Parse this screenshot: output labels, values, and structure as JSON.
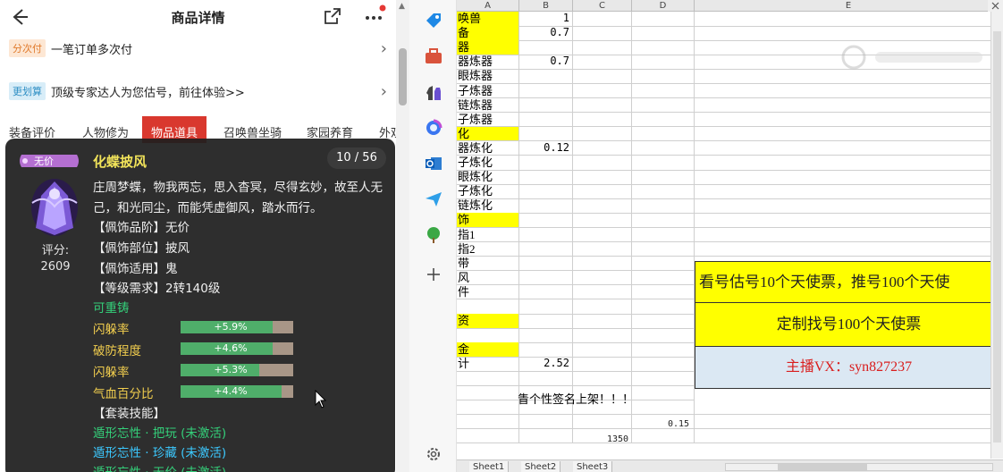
{
  "header": {
    "title": "商品详情"
  },
  "rows": [
    {
      "tag": "分次付",
      "text": "一笔订单多次付"
    },
    {
      "tag": "更划算",
      "text": "顶级专家达人为您估号，前往体验>>"
    }
  ],
  "tabs": [
    "装备评价",
    "人物修为",
    "物品道具",
    "召唤兽坐骑",
    "家园养育",
    "外观"
  ],
  "card": {
    "badge": "无价",
    "name": "化蝶披风",
    "counter": "10 / 56",
    "score_label": "评分:",
    "score": "2609",
    "desc": "庄周梦蝶，物我两忘，思入杳冥，尽得玄妙，故至人无己，和光同尘，而能凭虚御风，踏水而行。",
    "props": [
      "【佩饰品阶】无价",
      "【佩饰部位】披风",
      "【佩饰适用】鬼",
      "【等级需求】2转140级"
    ],
    "reforge": "可重铸",
    "stats": [
      {
        "name": "闪躲率",
        "value": "+5.9%",
        "fill": 0.82
      },
      {
        "name": "破防程度",
        "value": "+4.6%",
        "fill": 0.82
      },
      {
        "name": "闪躲率",
        "value": "+5.3%",
        "fill": 0.7
      },
      {
        "name": "气血百分比",
        "value": "+4.4%",
        "fill": 0.9
      }
    ],
    "set_skill": "【套装技能】",
    "skills": [
      "遁形忘性 · 把玩 (未激活)",
      "遁形忘性 · 珍藏 (未激活)",
      "遁形忘性 · 无价 (未激活)"
    ]
  },
  "spreadsheet": {
    "columns": [
      "A",
      "B",
      "C",
      "D",
      "E"
    ],
    "rows": [
      {
        "a": "唤兽",
        "b": "1",
        "yel": true
      },
      {
        "a": "备",
        "b": "0.7",
        "yel": true
      },
      {
        "a": "器",
        "b": "",
        "yel": true
      },
      {
        "a": "器炼器",
        "b": "0.7",
        "yel": false
      },
      {
        "a": "眼炼器",
        "b": "",
        "yel": false
      },
      {
        "a": "子炼器",
        "b": "",
        "yel": false
      },
      {
        "a": "链炼器",
        "b": "",
        "yel": false
      },
      {
        "a": "子炼器",
        "b": "",
        "yel": false
      },
      {
        "a": "化",
        "b": "",
        "yel": true
      },
      {
        "a": "器炼化",
        "b": "0.12",
        "yel": false
      },
      {
        "a": "子炼化",
        "b": "",
        "yel": false
      },
      {
        "a": "眼炼化",
        "b": "",
        "yel": false
      },
      {
        "a": "子炼化",
        "b": "",
        "yel": false
      },
      {
        "a": "链炼化",
        "b": "",
        "yel": false
      },
      {
        "a": "饰",
        "b": "",
        "yel": true
      },
      {
        "a": "指1",
        "b": "",
        "yel": false
      },
      {
        "a": "指2",
        "b": "",
        "yel": false
      },
      {
        "a": "带",
        "b": "",
        "yel": false
      },
      {
        "a": "风",
        "b": "",
        "yel": false
      },
      {
        "a": "件",
        "b": "",
        "yel": false
      },
      {
        "a": "",
        "b": "",
        "yel": false
      },
      {
        "a": "资",
        "b": "",
        "yel": true
      },
      {
        "a": "",
        "b": "",
        "yel": false
      },
      {
        "a": "金",
        "b": "",
        "yel": true
      },
      {
        "a": "计",
        "b": "2.52",
        "yel": false
      }
    ],
    "banner1": "看号估号10个天使票，推号100个天使",
    "banner2": "定制找号100个天使票",
    "banner3": "主播VX：syn827237",
    "sig": "眚个性签名上架！！！",
    "d_value": "0.15",
    "c_value": "1350",
    "sheet_tabs": [
      "Sheet1",
      "Sheet2",
      "Sheet3"
    ]
  }
}
